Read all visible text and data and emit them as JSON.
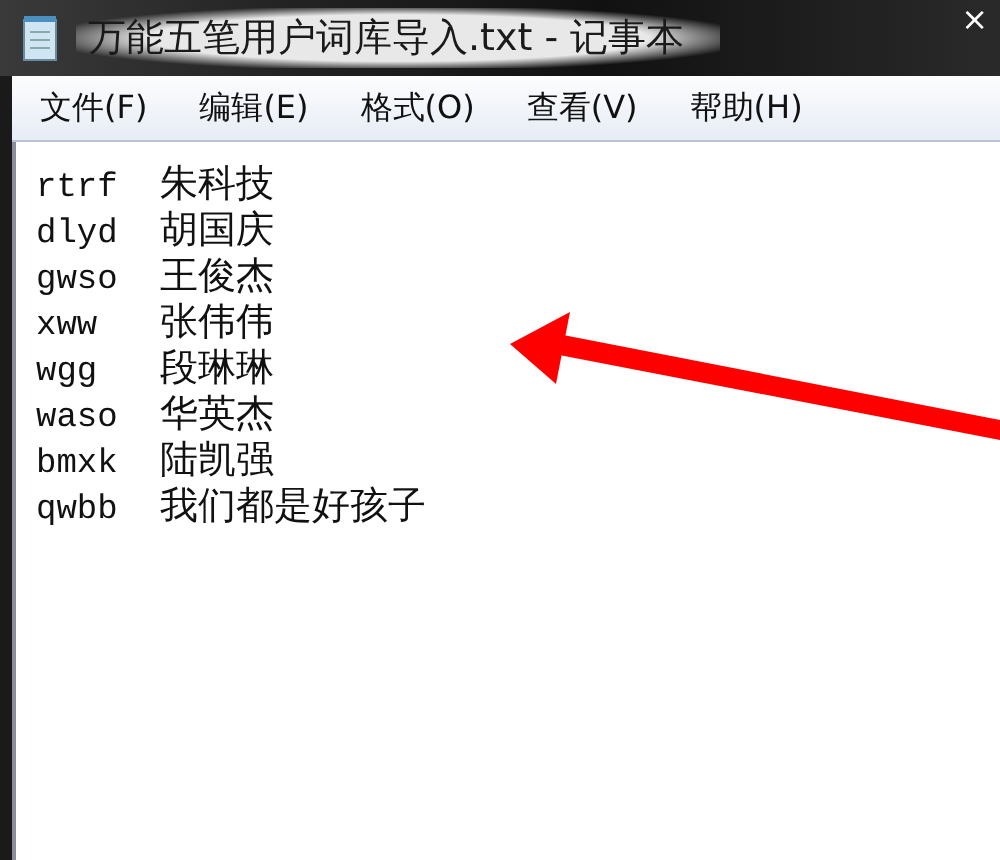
{
  "window": {
    "title": "万能五笔用户词库导入.txt - 记事本",
    "close": "×"
  },
  "menu": [
    {
      "label": "文件(F)"
    },
    {
      "label": "编辑(E)"
    },
    {
      "label": "格式(O)"
    },
    {
      "label": "查看(V)"
    },
    {
      "label": "帮助(H)"
    }
  ],
  "lines": [
    {
      "code": "rtrf",
      "word": "朱科技"
    },
    {
      "code": "dlyd",
      "word": "胡国庆"
    },
    {
      "code": "gwso",
      "word": "王俊杰"
    },
    {
      "code": "xww",
      "word": "张伟伟"
    },
    {
      "code": "wgg",
      "word": "段琳琳"
    },
    {
      "code": "waso",
      "word": "华英杰"
    },
    {
      "code": "bmxk",
      "word": "陆凯强"
    },
    {
      "code": "qwbb",
      "word": "我们都是好孩子"
    }
  ],
  "annotations": [
    {
      "kind": "arrow"
    }
  ]
}
